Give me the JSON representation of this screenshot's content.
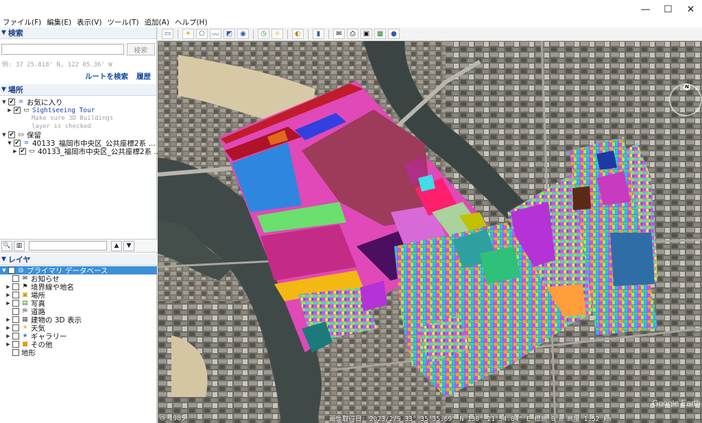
{
  "menu": [
    "ファイル(F)",
    "編集(E)",
    "表示(V)",
    "ツール(T)",
    "追加(A)",
    "ヘルプ(H)"
  ],
  "window_controls": {
    "minimize": "—",
    "maximize": "☐",
    "close": "✕"
  },
  "search": {
    "header": "検索",
    "button": "検索",
    "input_value": "",
    "placeholder": "",
    "coord_hint": "例: 37 25.818' N, 122 05.36' W",
    "route_link": "ルートを検索",
    "history_link": "履歴"
  },
  "places": {
    "header": "場所",
    "favorites": "お気に入り",
    "sightseeing": "Sightseeing Tour",
    "note_line1": "Make sure 3D Buildings",
    "note_line2": "layer is checked",
    "hold": "保留",
    "item1": "40133_福岡市中央区_公共座標2系 …",
    "item2": "40133_福岡市中央区_公共座標2系 …"
  },
  "layers": {
    "header": "レイヤ",
    "primary_db": "プライマリ データベース",
    "items": [
      "お知らせ",
      "境界線や地名",
      "場所",
      "写真",
      "道路",
      "建物の 3D 表示",
      "天気",
      "ギャラリー",
      "その他",
      "地形"
    ]
  },
  "status": {
    "year": "1985",
    "text": "画像取得日: 2023/2/9   33° 35'35.69\" N 130° 21'54.04\" E 標高     0 m  高度   1.52 km",
    "watermark": "Google Earth",
    "compass_n": "N"
  },
  "colors": {
    "accent_blue": "#1c3f8c",
    "highlight": "#3d8fd6",
    "link_blue": "#1a3fc0"
  }
}
